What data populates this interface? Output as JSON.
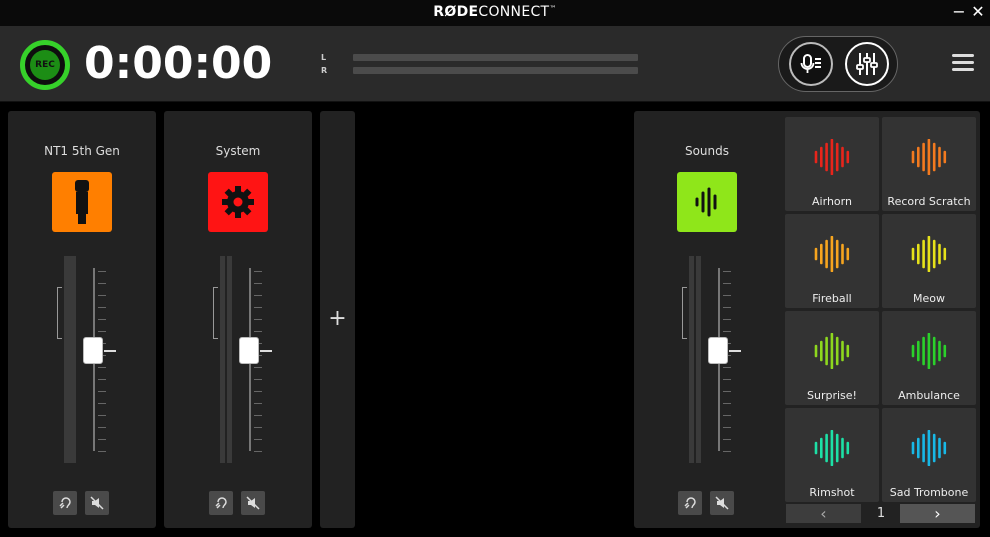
{
  "app": {
    "title_bold": "RØDE",
    "title_light": "CONNECT",
    "trademark": "™",
    "minimize": "−",
    "close": "✕"
  },
  "topbar": {
    "rec_label": "REC",
    "timer": "0:00:00",
    "left_label": "L",
    "right_label": "R",
    "icons": [
      "mic-settings-icon",
      "mixer-sliders-icon",
      "hamburger-menu-icon"
    ]
  },
  "channels": [
    {
      "name": "NT1 5th Gen",
      "icon": "microphone-icon",
      "color": "#ff7f00",
      "fader_level": 0.55
    },
    {
      "name": "System",
      "icon": "gear-icon",
      "color": "#ff1414",
      "fader_level": 0.55
    },
    {
      "name": "Sounds",
      "icon": "sound-wave-icon",
      "color": "#8fe61a",
      "fader_level": 0.55
    }
  ],
  "add_channel": "+",
  "sound_pads": [
    {
      "label": "Airhorn",
      "color": "#e8251b"
    },
    {
      "label": "Record Scratch",
      "color": "#f37a1f"
    },
    {
      "label": "Fireball",
      "color": "#f7a51f"
    },
    {
      "label": "Meow",
      "color": "#e6e21a"
    },
    {
      "label": "Surprise!",
      "color": "#8ed81e"
    },
    {
      "label": "Ambulance",
      "color": "#2bd12b"
    },
    {
      "label": "Rimshot",
      "color": "#1de0a6"
    },
    {
      "label": "Sad Trombone",
      "color": "#18b8e6"
    }
  ],
  "pager": {
    "prev": "‹",
    "next": "›",
    "page": "1"
  }
}
